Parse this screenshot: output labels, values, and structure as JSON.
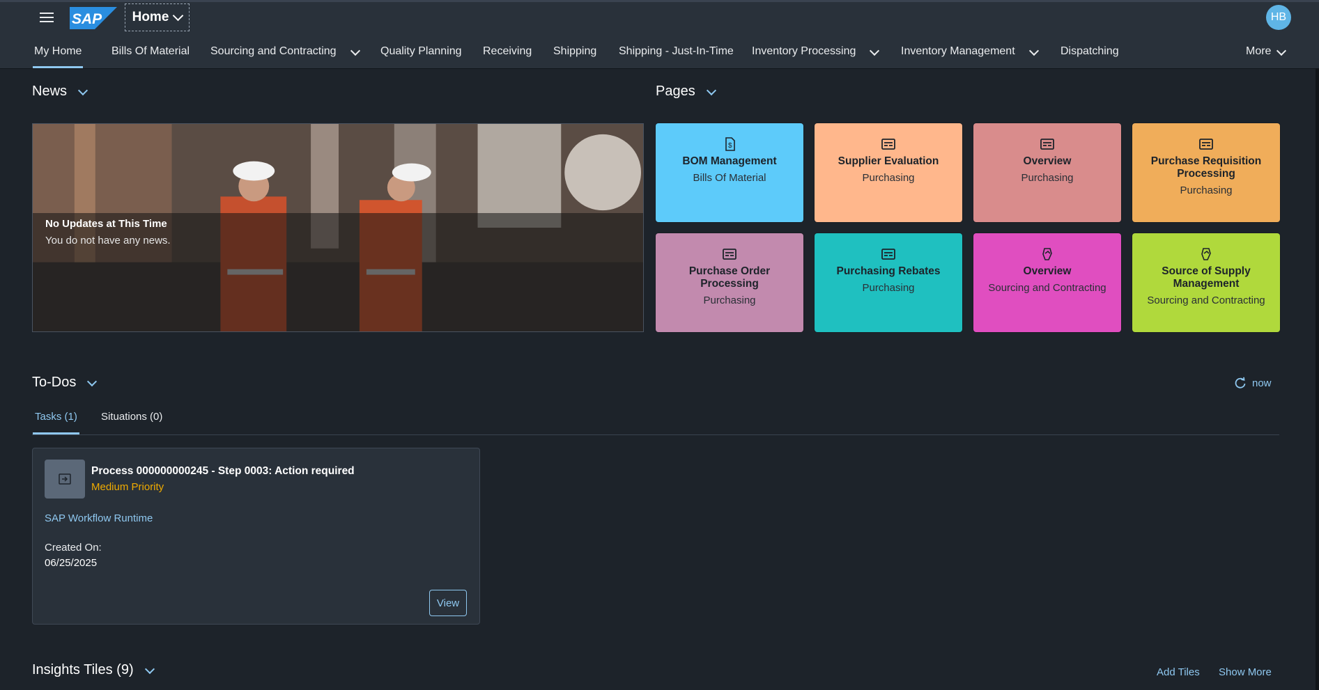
{
  "shell": {
    "logo_text": "SAP",
    "home_label": "Home",
    "avatar_initials": "HB"
  },
  "nav": {
    "items": [
      {
        "label": "My Home",
        "active": true,
        "has_menu": false
      },
      {
        "label": "Bills Of Material",
        "has_menu": false
      },
      {
        "label": "Sourcing and Contracting",
        "has_menu": true
      },
      {
        "label": "Quality Planning",
        "has_menu": false
      },
      {
        "label": "Receiving",
        "has_menu": false
      },
      {
        "label": "Shipping",
        "has_menu": false
      },
      {
        "label": "Shipping - Just-In-Time",
        "has_menu": false
      },
      {
        "label": "Inventory Processing",
        "has_menu": true
      },
      {
        "label": "Inventory Management",
        "has_menu": true
      },
      {
        "label": "Dispatching",
        "has_menu": false
      }
    ],
    "more_label": "More"
  },
  "news": {
    "section_title": "News",
    "headline": "No Updates at This Time",
    "message": "You do not have any news."
  },
  "pages": {
    "section_title": "Pages",
    "tiles": [
      {
        "title": "BOM Management",
        "subtitle": "Bills Of Material",
        "color": "#5dcbfa",
        "icon": "document-dollar-icon"
      },
      {
        "title": "Supplier Evaluation",
        "subtitle": "Purchasing",
        "color": "#ffb78c",
        "icon": "card-icon"
      },
      {
        "title": "Overview",
        "subtitle": "Purchasing",
        "color": "#d98c8c",
        "icon": "card-icon"
      },
      {
        "title": "Purchase Requisition Processing",
        "subtitle": "Purchasing",
        "color": "#f0ad5a",
        "icon": "card-icon"
      },
      {
        "title": "Purchase Order Processing",
        "subtitle": "Purchasing",
        "color": "#c28aae",
        "icon": "card-icon"
      },
      {
        "title": "Purchasing Rebates",
        "subtitle": "Purchasing",
        "color": "#1fc0c0",
        "icon": "card-icon"
      },
      {
        "title": "Overview",
        "subtitle": "Sourcing and Contracting",
        "color": "#e04ec0",
        "icon": "handshake-icon"
      },
      {
        "title": "Source of Supply Management",
        "subtitle": "Sourcing and Contracting",
        "color": "#b0d93c",
        "icon": "handshake-icon"
      }
    ]
  },
  "todos": {
    "section_title": "To-Dos",
    "refresh_label": "now",
    "tabs": [
      {
        "label": "Tasks (1)",
        "active": true
      },
      {
        "label": "Situations (0)",
        "active": false
      }
    ],
    "task": {
      "title": "Process 000000000245 - Step 0003: Action required",
      "priority": "Medium Priority",
      "source": "SAP Workflow Runtime",
      "created_label": "Created On:",
      "created_value": "06/25/2025",
      "action_label": "View"
    }
  },
  "insights": {
    "section_title": "Insights Tiles (9)",
    "add_label": "Add Tiles",
    "show_more_label": "Show More"
  }
}
